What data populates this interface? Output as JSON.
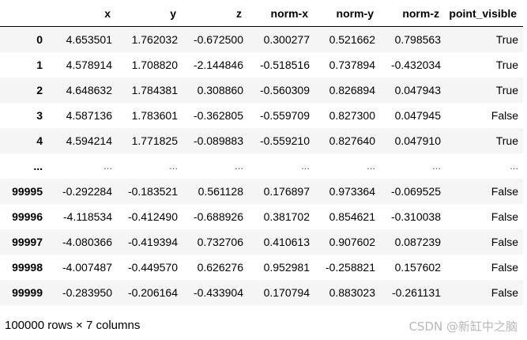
{
  "columns": [
    "x",
    "y",
    "z",
    "norm-x",
    "norm-y",
    "norm-z",
    "point_visible"
  ],
  "rows": [
    {
      "index": "0",
      "cells": [
        "4.653501",
        "1.762032",
        "-0.672500",
        "0.300277",
        "0.521662",
        "0.798563",
        "True"
      ]
    },
    {
      "index": "1",
      "cells": [
        "4.578914",
        "1.708820",
        "-2.144846",
        "-0.518516",
        "0.737894",
        "-0.432034",
        "True"
      ]
    },
    {
      "index": "2",
      "cells": [
        "4.648632",
        "1.784381",
        "0.308860",
        "-0.560309",
        "0.826894",
        "0.047943",
        "True"
      ]
    },
    {
      "index": "3",
      "cells": [
        "4.587136",
        "1.783601",
        "-0.362805",
        "-0.559709",
        "0.827300",
        "0.047945",
        "False"
      ]
    },
    {
      "index": "4",
      "cells": [
        "4.594214",
        "1.771825",
        "-0.089883",
        "-0.559210",
        "0.827640",
        "0.047910",
        "True"
      ]
    },
    {
      "index": "...",
      "cells": [
        "...",
        "...",
        "...",
        "...",
        "...",
        "...",
        "..."
      ]
    },
    {
      "index": "99995",
      "cells": [
        "-0.292284",
        "-0.183521",
        "0.561128",
        "0.176897",
        "0.973364",
        "-0.069525",
        "False"
      ]
    },
    {
      "index": "99996",
      "cells": [
        "-4.118534",
        "-0.412490",
        "-0.688926",
        "0.381702",
        "0.854621",
        "-0.310038",
        "False"
      ]
    },
    {
      "index": "99997",
      "cells": [
        "-4.080366",
        "-0.419394",
        "0.732706",
        "0.410613",
        "0.907602",
        "0.087239",
        "False"
      ]
    },
    {
      "index": "99998",
      "cells": [
        "-4.007487",
        "-0.449570",
        "0.626276",
        "0.952981",
        "-0.258821",
        "0.157602",
        "False"
      ]
    },
    {
      "index": "99999",
      "cells": [
        "-0.283950",
        "-0.206164",
        "-0.433904",
        "0.170794",
        "0.883023",
        "-0.261131",
        "False"
      ]
    }
  ],
  "shape_caption": "100000 rows × 7 columns",
  "watermark": "CSDN @新缸中之脑"
}
